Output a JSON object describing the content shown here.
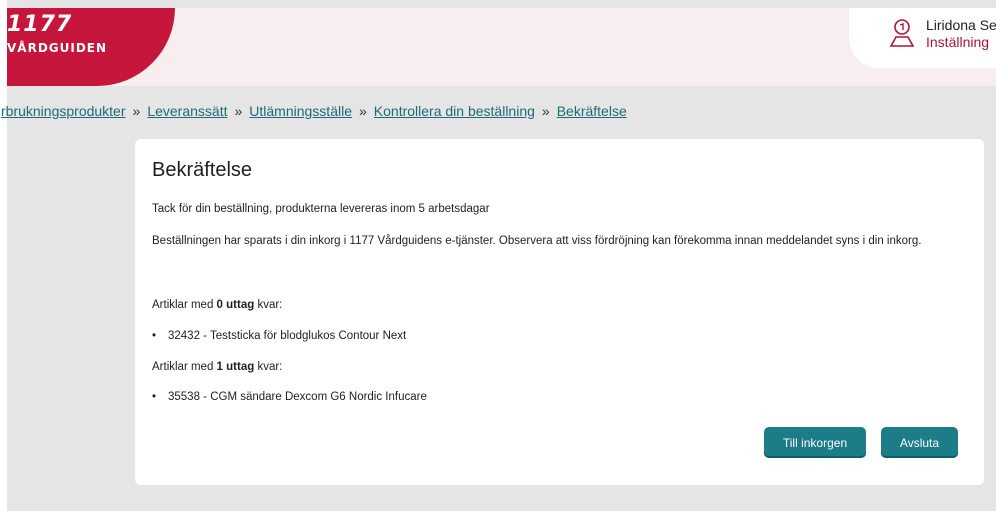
{
  "header": {
    "logo_number": "1177",
    "logo_text": "VÅRDGUIDEN",
    "user_name": "Liridona Se",
    "settings_link": "Inställning"
  },
  "breadcrumb": {
    "items": [
      "rbrukningsprodukter",
      "Leveranssätt",
      "Utlämningsställe",
      "Kontrollera din beställning",
      "Bekräftelse"
    ],
    "separator": "»"
  },
  "confirmation": {
    "title": "Bekräftelse",
    "thanks": "Tack för din beställning, produkterna levereras inom 5 arbetsdagar",
    "saved_message": "Beställningen har sparats i din inkorg i 1177 Vårdguidens e-tjänster. Observera att viss fördröjning kan förekomma innan meddelandet syns i din inkorg.",
    "group0": {
      "prefix": "Artiklar med ",
      "bold": "0 uttag",
      "suffix": " kvar:",
      "item": "32432 - Teststicka för blodglukos Contour Next"
    },
    "group1": {
      "prefix": "Artiklar med ",
      "bold": "1 uttag",
      "suffix": " kvar:",
      "item": "35538 - CGM sändare Dexcom G6 Nordic Infucare"
    },
    "bullet": "•"
  },
  "actions": {
    "inbox_label": "Till inkorgen",
    "finish_label": "Avsluta"
  },
  "colors": {
    "brand_red": "#c6163c",
    "button_teal": "#1c7c88",
    "link_teal": "#1e6a78"
  }
}
